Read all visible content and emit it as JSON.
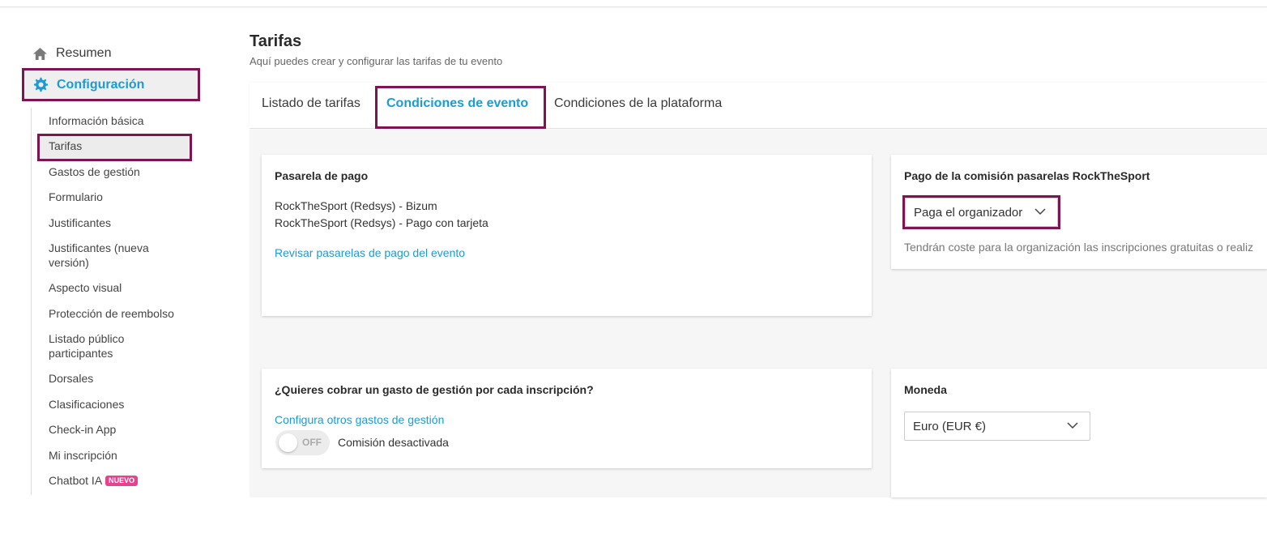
{
  "sidebar": {
    "resumen": "Resumen",
    "configuracion": "Configuración",
    "items": [
      "Información básica",
      "Tarifas",
      "Gastos de gestión",
      "Formulario",
      "Justificantes",
      "Justificantes (nueva versión)",
      "Aspecto visual",
      "Protección de reembolso",
      "Listado público participantes",
      "Dorsales",
      "Clasificaciones",
      "Check-in App",
      "Mi inscripción",
      "Chatbot IA"
    ],
    "new_badge": "NUEVO"
  },
  "page": {
    "title": "Tarifas",
    "subtitle": "Aquí puedes crear y configurar las tarifas de tu evento"
  },
  "tabs": [
    {
      "label": "Listado de tarifas",
      "active": false
    },
    {
      "label": "Condiciones de evento",
      "active": true
    },
    {
      "label": "Condiciones de la plataforma",
      "active": false
    }
  ],
  "payment_gateway": {
    "title": "Pasarela de pago",
    "methods": [
      "RockTheSport (Redsys) - Bizum",
      "RockTheSport (Redsys) - Pago con tarjeta"
    ],
    "review_link": "Revisar pasarelas de pago del evento"
  },
  "commission": {
    "title": "Pago de la comisión pasarelas RockTheSport",
    "selected": "Paga el organizador",
    "note": "Tendrán coste para la organización las inscripciones gratuitas o realiz"
  },
  "management_fee": {
    "title": "¿Quieres cobrar un gasto de gestión por cada inscripción?",
    "link": "Configura otros gastos de gestión",
    "toggle_label": "OFF",
    "toggle_on": false,
    "status": "Comisión desactivada"
  },
  "currency": {
    "title": "Moneda",
    "selected": "Euro (EUR €)"
  },
  "colors": {
    "accent": "#1a9cd6",
    "highlight": "#7d1552",
    "badge": "#e8418e"
  },
  "icons": {
    "home": "home-icon",
    "config": "gear-icon",
    "dropdown": "chevron-down-icon"
  }
}
